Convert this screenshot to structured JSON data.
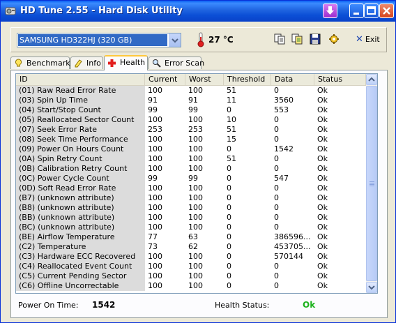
{
  "window": {
    "title": "HD Tune 2.55 - Hard Disk Utility"
  },
  "toolbar": {
    "drive": "SAMSUNG HD322HJ (320 GB)",
    "temperature": "27 °C",
    "exit_label": "Exit",
    "icons": [
      "copy-icon",
      "copy-screenshot-icon",
      "save-icon",
      "options-icon"
    ]
  },
  "tabs": [
    {
      "label": "Benchmark",
      "icon": "benchmark-icon"
    },
    {
      "label": "Info",
      "icon": "info-icon"
    },
    {
      "label": "Health",
      "icon": "health-icon",
      "active": true
    },
    {
      "label": "Error Scan",
      "icon": "error-scan-icon"
    }
  ],
  "table": {
    "columns": [
      "ID",
      "Current",
      "Worst",
      "Threshold",
      "Data",
      "Status"
    ],
    "rows": [
      [
        "(01) Raw Read Error Rate",
        "100",
        "100",
        "51",
        "0",
        "Ok"
      ],
      [
        "(03) Spin Up Time",
        "91",
        "91",
        "11",
        "3560",
        "Ok"
      ],
      [
        "(04) Start/Stop Count",
        "99",
        "99",
        "0",
        "553",
        "Ok"
      ],
      [
        "(05) Reallocated Sector Count",
        "100",
        "100",
        "10",
        "0",
        "Ok"
      ],
      [
        "(07) Seek Error Rate",
        "253",
        "253",
        "51",
        "0",
        "Ok"
      ],
      [
        "(08) Seek Time Performance",
        "100",
        "100",
        "15",
        "0",
        "Ok"
      ],
      [
        "(09) Power On Hours Count",
        "100",
        "100",
        "0",
        "1542",
        "Ok"
      ],
      [
        "(0A) Spin Retry Count",
        "100",
        "100",
        "51",
        "0",
        "Ok"
      ],
      [
        "(0B) Calibration Retry Count",
        "100",
        "100",
        "0",
        "0",
        "Ok"
      ],
      [
        "(0C) Power Cycle Count",
        "99",
        "99",
        "0",
        "547",
        "Ok"
      ],
      [
        "(0D) Soft Read Error Rate",
        "100",
        "100",
        "0",
        "0",
        "Ok"
      ],
      [
        "(B7) (unknown attribute)",
        "100",
        "100",
        "0",
        "0",
        "Ok"
      ],
      [
        "(B8) (unknown attribute)",
        "100",
        "100",
        "0",
        "0",
        "Ok"
      ],
      [
        "(BB) (unknown attribute)",
        "100",
        "100",
        "0",
        "0",
        "Ok"
      ],
      [
        "(BC) (unknown attribute)",
        "100",
        "100",
        "0",
        "0",
        "Ok"
      ],
      [
        "(BE) Airflow Temperature",
        "77",
        "63",
        "0",
        "386596...",
        "Ok"
      ],
      [
        "(C2) Temperature",
        "73",
        "62",
        "0",
        "453705...",
        "Ok"
      ],
      [
        "(C3) Hardware ECC Recovered",
        "100",
        "100",
        "0",
        "570144",
        "Ok"
      ],
      [
        "(C4) Reallocated Event Count",
        "100",
        "100",
        "0",
        "0",
        "Ok"
      ],
      [
        "(C5) Current Pending Sector",
        "100",
        "100",
        "0",
        "0",
        "Ok"
      ],
      [
        "(C6) Offline Uncorrectable",
        "100",
        "100",
        "0",
        "0",
        "Ok"
      ]
    ]
  },
  "footer": {
    "power_on_label": "Power On Time:",
    "power_on_value": "1542",
    "health_label": "Health Status:",
    "health_value": "Ok"
  },
  "colors": {
    "titlebar": "#0b4fd6",
    "selection": "#316ac5",
    "health_ok": "#1cb21c",
    "tab_highlight": "#ffc83c"
  }
}
